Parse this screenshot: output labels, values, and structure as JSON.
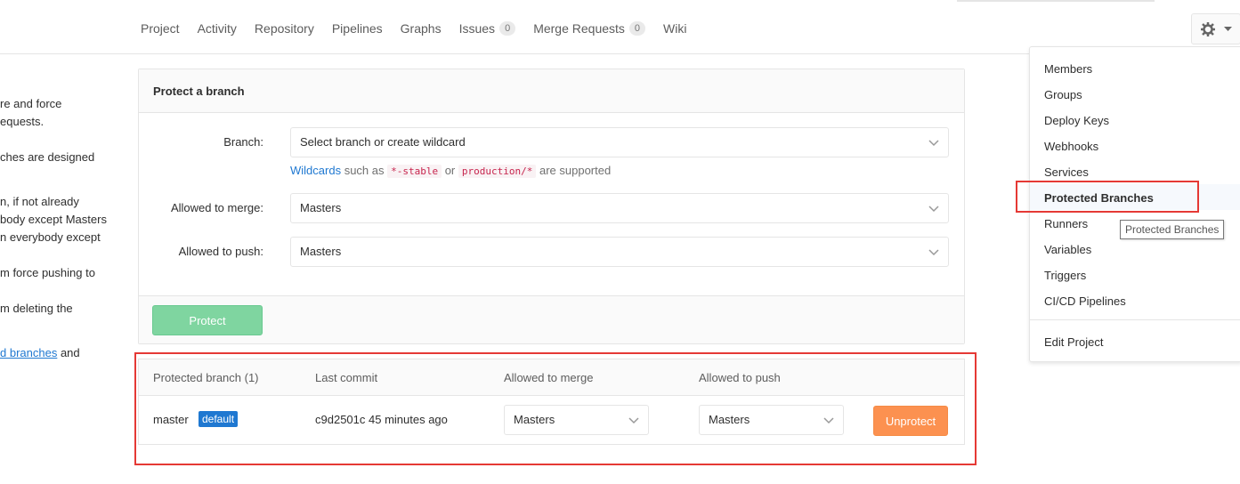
{
  "nav": {
    "tabs": [
      {
        "label": "Project"
      },
      {
        "label": "Activity"
      },
      {
        "label": "Repository"
      },
      {
        "label": "Pipelines"
      },
      {
        "label": "Graphs"
      },
      {
        "label": "Issues",
        "count": "0"
      },
      {
        "label": "Merge Requests",
        "count": "0"
      },
      {
        "label": "Wiki"
      }
    ]
  },
  "sidebar_text": {
    "lines": [
      "re and force",
      "equests.",
      "ches are designed",
      "n, if not already",
      "body except Masters",
      "n everybody except",
      "m force pushing to",
      "m deleting the"
    ],
    "link": "d branches",
    "link_suffix": " and"
  },
  "protect_panel": {
    "title": "Protect a branch",
    "branch_label": "Branch:",
    "branch_placeholder": "Select branch or create wildcard",
    "hint_link": "Wildcards",
    "hint_text1": " such as ",
    "hint_code1": "*-stable",
    "hint_text2": " or ",
    "hint_code2": "production/*",
    "hint_text3": " are supported",
    "merge_label": "Allowed to merge:",
    "merge_value": "Masters",
    "push_label": "Allowed to push:",
    "push_value": "Masters",
    "protect_button": "Protect"
  },
  "protected_table": {
    "headers": {
      "branch": "Protected branch (1)",
      "commit": "Last commit",
      "merge": "Allowed to merge",
      "push": "Allowed to push"
    },
    "rows": [
      {
        "branch": "master",
        "badge": "default",
        "commit": "c9d2501c 45 minutes ago",
        "merge": "Masters",
        "push": "Masters",
        "action": "Unprotect"
      }
    ]
  },
  "settings_menu": {
    "items": [
      "Members",
      "Groups",
      "Deploy Keys",
      "Webhooks",
      "Services",
      "Protected Branches",
      "Runners",
      "Variables",
      "Triggers",
      "CI/CD Pipelines"
    ],
    "footer_item": "Edit Project",
    "tooltip": "Protected Branches"
  },
  "colors": {
    "link": "#1f78d1",
    "protect_button": "#7fd5a0",
    "unprotect_button": "#fc9150",
    "default_badge": "#1f78d1",
    "highlight_box": "#e53935"
  }
}
